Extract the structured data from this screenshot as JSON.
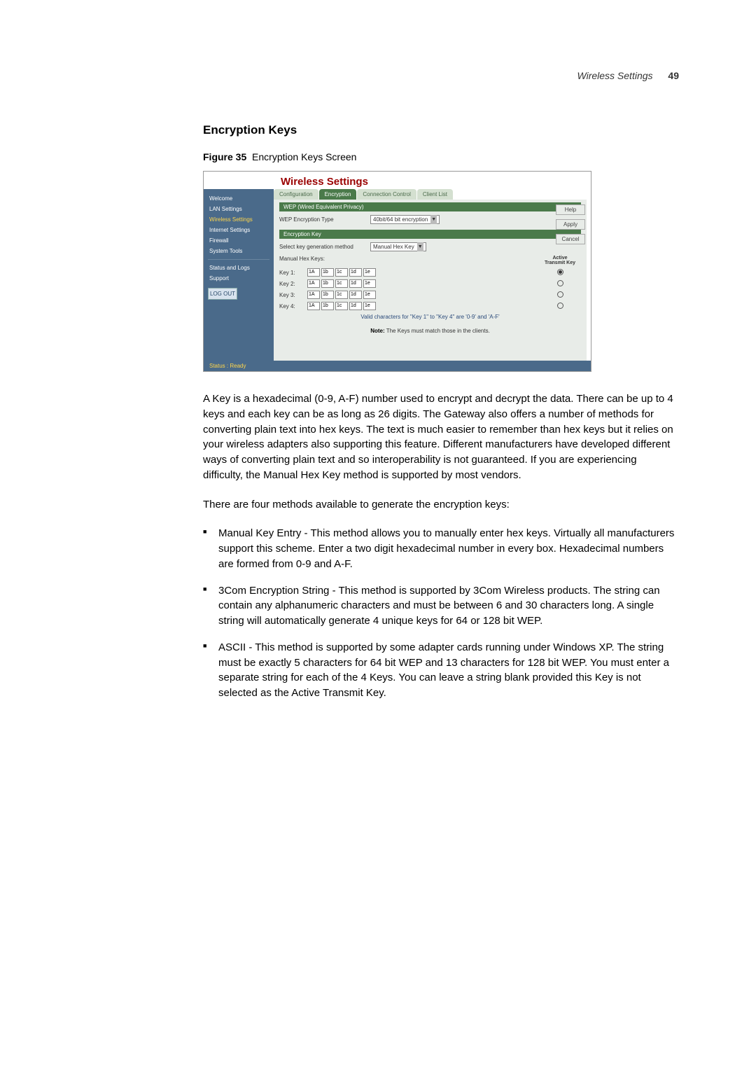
{
  "header": {
    "page_label": "Wireless Settings",
    "page_number": "49"
  },
  "section": {
    "title": "Encryption Keys",
    "figure_label": "Figure 35",
    "figure_title": "Encryption Keys Screen"
  },
  "screenshot": {
    "title": "Wireless Settings",
    "tabs": [
      "Configuration",
      "Encryption",
      "Connection Control",
      "Client List"
    ],
    "sidebar": {
      "items": [
        "Welcome",
        "LAN Settings",
        "Wireless Settings",
        "Internet Settings",
        "Firewall",
        "System Tools",
        "Status and Logs",
        "Support"
      ],
      "logout": "LOG OUT"
    },
    "wep_section": {
      "heading": "WEP (Wired Equivalent Privacy)",
      "type_label": "WEP Encryption Type",
      "type_value": "40bit/64 bit encryption"
    },
    "key_section": {
      "heading": "Encryption Key",
      "method_label": "Select key generation method",
      "method_value": "Manual Hex Key",
      "manual_label": "Manual Hex Keys:",
      "active_label": "Active\nTransmit Key",
      "keys": [
        {
          "label": "Key 1:",
          "cells": [
            "1A",
            "1b",
            "1c",
            "1d",
            "1e"
          ],
          "active": true
        },
        {
          "label": "Key 2:",
          "cells": [
            "1A",
            "1b",
            "1c",
            "1d",
            "1e"
          ],
          "active": false
        },
        {
          "label": "Key 3:",
          "cells": [
            "1A",
            "1b",
            "1c",
            "1d",
            "1e"
          ],
          "active": false
        },
        {
          "label": "Key 4:",
          "cells": [
            "1A",
            "1b",
            "1c",
            "1d",
            "1e"
          ],
          "active": false
        }
      ],
      "valid_note": "Valid characters for \"Key 1\" to \"Key 4\" are '0-9' and 'A-F'",
      "match_note_label": "Note:",
      "match_note_text": "The Keys must match those in the clients."
    },
    "buttons": [
      "Help",
      "Apply",
      "Cancel"
    ],
    "status": "Status : Ready"
  },
  "body": {
    "para1": "A Key is a hexadecimal (0-9, A-F) number used to encrypt and decrypt the data. There can be up to 4 keys and each key can be as long as 26 digits. The Gateway also offers a number of methods for converting plain text into hex keys. The text is much easier to remember than hex keys but it relies on your wireless adapters also supporting this feature. Different manufacturers have developed different ways of converting plain text and so interoperability is not guaranteed. If you are experiencing difficulty, the Manual Hex Key method is supported by most vendors.",
    "para2": "There are four methods available to generate the encryption keys:",
    "bullets": [
      "Manual Key Entry - This method allows you to manually enter hex keys. Virtually all manufacturers support this scheme. Enter a two digit hexadecimal number in every box. Hexadecimal numbers are formed from 0-9 and A-F.",
      "3Com Encryption String - This method is supported by 3Com Wireless products. The string can contain any alphanumeric characters and must be between 6 and 30 characters long. A single string will automatically generate 4 unique keys for 64 or 128 bit WEP.",
      "ASCII - This method is supported by some adapter cards running under Windows XP. The string must be exactly 5 characters for 64 bit WEP and 13 characters for 128 bit WEP. You must enter a separate string for each of the 4 Keys. You can leave a string blank provided this Key is not selected as the Active Transmit Key."
    ]
  }
}
